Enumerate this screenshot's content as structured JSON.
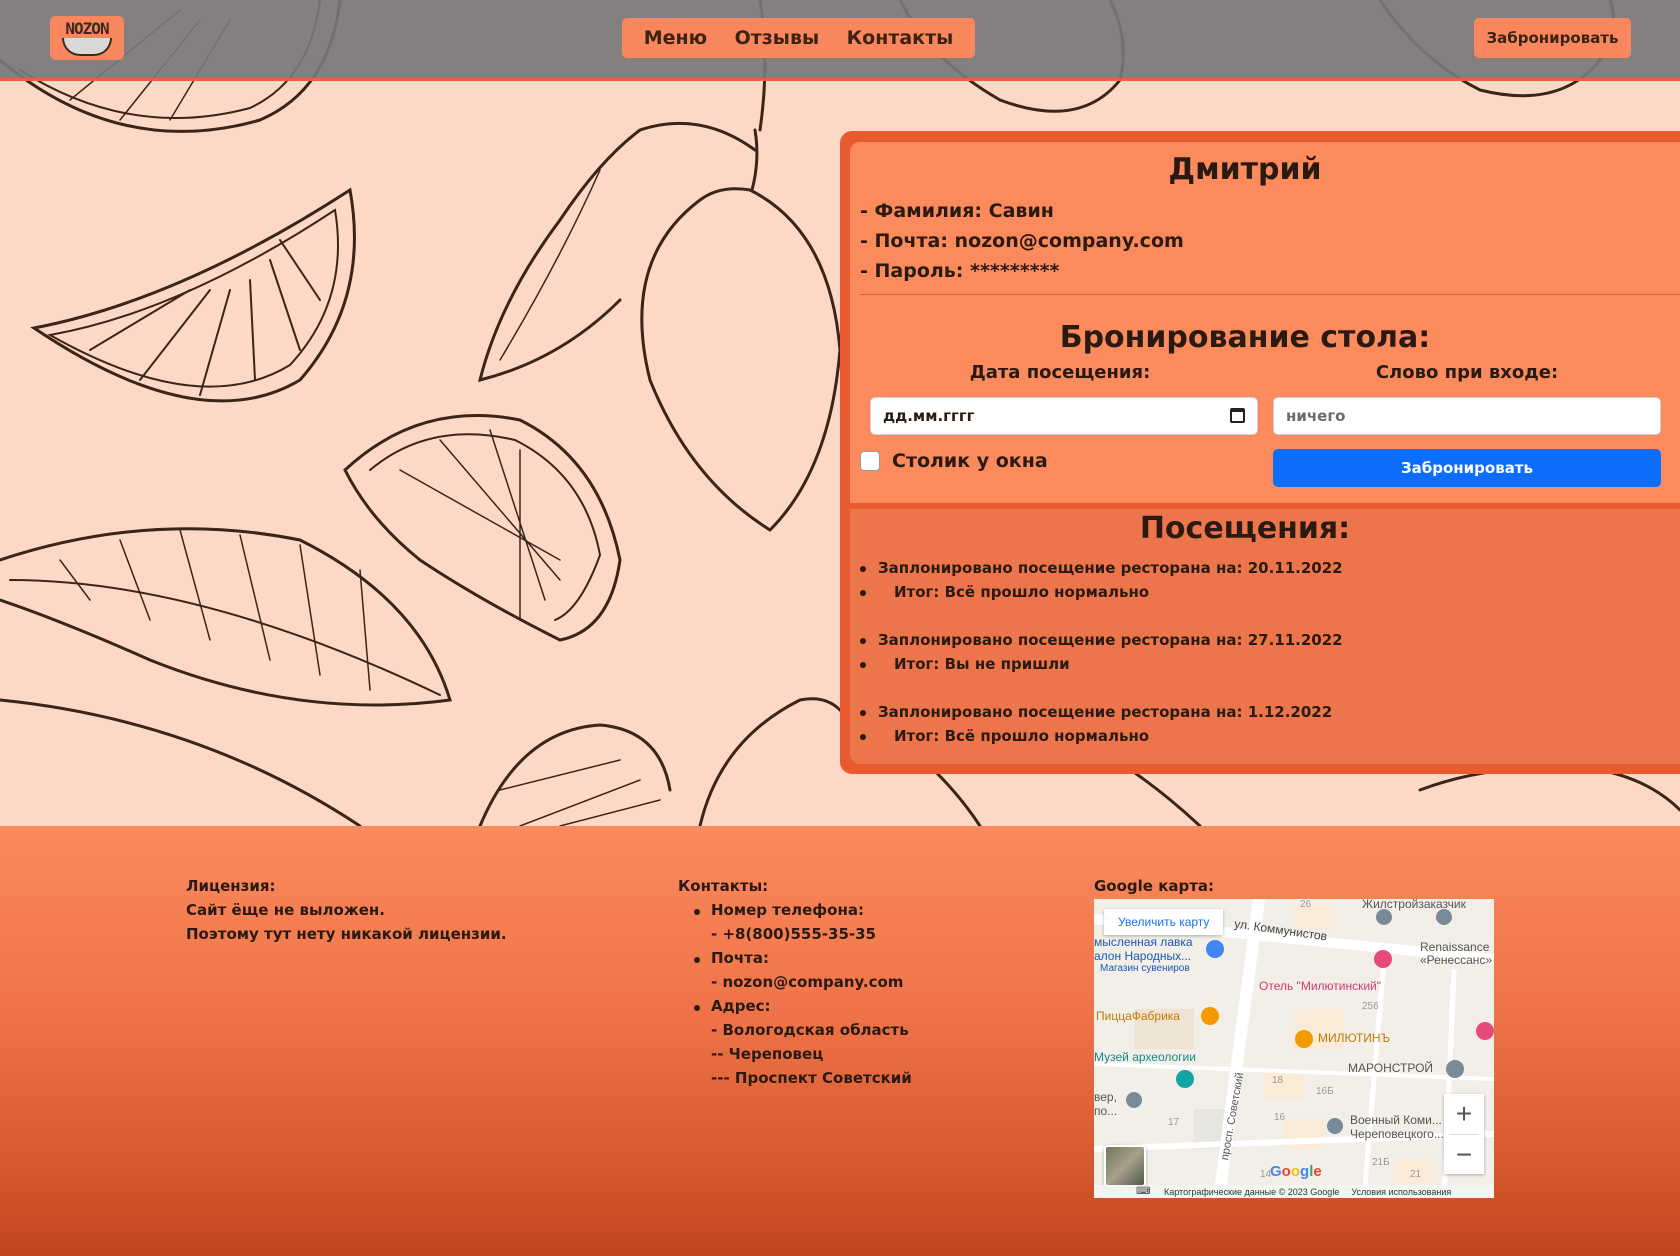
{
  "header": {
    "logo_text": "NOZON",
    "nav": [
      "Меню",
      "Отзывы",
      "Контакты"
    ],
    "book_button": "Забронировать"
  },
  "profile": {
    "name": "Дмитрий",
    "surname_line": "- Фамилия: Савин",
    "email_line": "- Почта: nozon@company.com",
    "password_line": "- Пароль: *********"
  },
  "booking": {
    "title": "Бронирование стола:",
    "date_label": "Дата посещения:",
    "date_placeholder": "дд.мм.гггг",
    "word_label": "Слово при входе:",
    "word_placeholder": "ничего",
    "window_label": "Столик у окна",
    "submit_label": "Забронировать"
  },
  "visits": {
    "title": "Посещения:",
    "items": [
      {
        "planned": "Заплонировано посещение ресторана на: 20.11.2022",
        "result": "Итог: Всё прошло нормально"
      },
      {
        "planned": "Заплонировано посещение ресторана на: 27.11.2022",
        "result": "Итог: Вы не пришли"
      },
      {
        "planned": "Заплонировано посещение ресторана на: 1.12.2022",
        "result": "Итог: Всё прошло нормально"
      }
    ]
  },
  "footer": {
    "license": {
      "title": "Лицензия:",
      "lines": [
        "Сайт ёще не выложен.",
        "Поэтому тут нету никакой лицензии."
      ]
    },
    "contacts": {
      "title": "Контакты:",
      "phone_label": "Номер телефона:",
      "phone": "- +8(800)555-35-35",
      "mail_label": "Почта:",
      "mail": "- nozon@company.com",
      "address_label": "Адрес:",
      "address": [
        "- Вологодская область",
        "-- Череповец",
        "--- Проспект Советский"
      ]
    },
    "map": {
      "title": "Google карта:",
      "enlarge": "Увеличить карту",
      "labels": {
        "street_top": "ул. Коммунистов",
        "street_left": "просп. Советский",
        "zhilstroy": "Жилстройзаказчик",
        "renaissance": "Renaissance «Ренессанс»",
        "lavka": "мысленная лавка",
        "salon": "алон Народных...",
        "souvenir": "Магазин сувениров",
        "hotel": "Отель \"Милютинский\"",
        "pizza": "ПиццаФабрика",
        "milutin": "МИЛЮТИНЪ",
        "museum": "Музей археологии",
        "maronstroy": "МАРОНСТРОЙ",
        "sever": "вер,",
        "sever2": "по...",
        "military": "Военный Коми...",
        "military2": "Череповецкого...",
        "n26": "26",
        "n256": "256",
        "n18": "18",
        "n16b": "16Б",
        "n17": "17",
        "n16": "16",
        "n21b": "21Б",
        "n14": "14",
        "n21": "21"
      },
      "zoom_in": "+",
      "zoom_out": "−",
      "google": "Google",
      "attribution": "Картографические данные © 2023 Google",
      "terms": "Условия использования"
    }
  },
  "colors": {
    "accent": "#f9875e",
    "card_border": "#e95b2e",
    "primary_button": "#0d6efd",
    "header_bg": "#787878",
    "page_bg": "#fdd8c6"
  }
}
